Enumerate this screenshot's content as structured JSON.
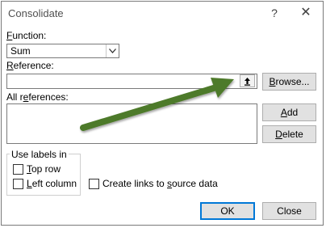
{
  "window": {
    "title": "Consolidate",
    "help": "?",
    "close": "✕"
  },
  "function": {
    "label": "Function:",
    "value": "Sum"
  },
  "reference": {
    "label": "Reference:",
    "value": "",
    "browse_label": "Browse..."
  },
  "all_references": {
    "label": "All references:",
    "add_label": "Add",
    "delete_label": "Delete"
  },
  "use_labels": {
    "title": "Use labels in",
    "top_row": {
      "label": "Top row",
      "checked": false
    },
    "left_column": {
      "label": "Left column",
      "checked": false
    }
  },
  "create_links": {
    "label": "Create links to source data",
    "checked": false
  },
  "footer": {
    "ok_label": "OK",
    "close_label": "Close"
  },
  "annotation": {
    "arrow_color": "#4e7a2a"
  }
}
